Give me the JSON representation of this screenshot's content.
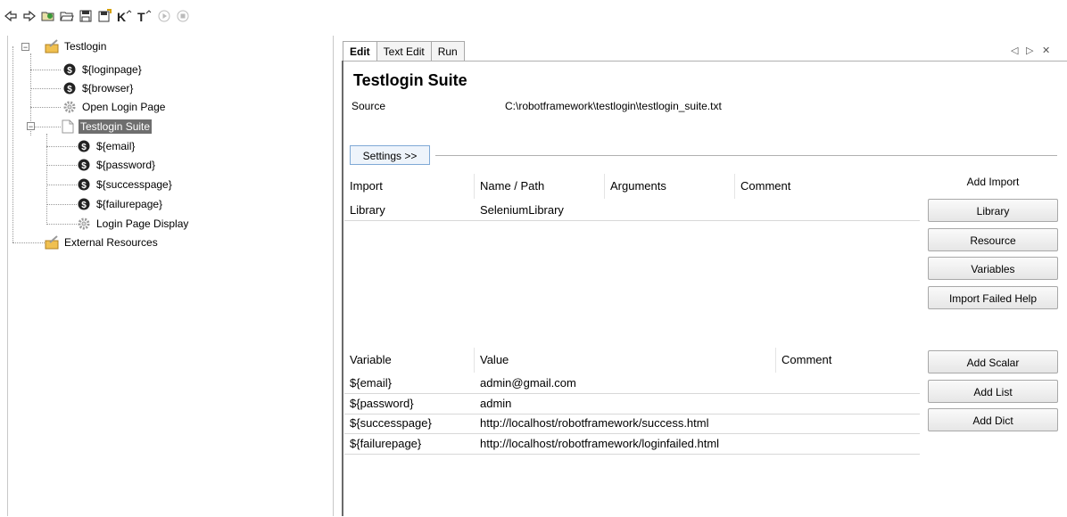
{
  "toolbar": {
    "icons": [
      "back-arrow-icon",
      "forward-arrow-icon",
      "open-directory-icon",
      "open-folder-icon",
      "save-icon",
      "save-all-icon",
      "keyword-search-icon",
      "test-search-icon",
      "run-icon",
      "stop-icon"
    ]
  },
  "tree": {
    "root": "Testlogin",
    "root_children": [
      "${loginpage}",
      "${browser}",
      "Open Login Page"
    ],
    "suite": "Testlogin Suite",
    "suite_children": [
      "${email}",
      "${password}",
      "${successpage}",
      "${failurepage}",
      "Login Page Display"
    ],
    "external": "External Resources"
  },
  "tabs": [
    "Edit",
    "Text Edit",
    "Run"
  ],
  "tab_controls": {
    "prev": "◁",
    "next": "▷",
    "close": "✕"
  },
  "editor": {
    "title": "Testlogin Suite",
    "source_label": "Source",
    "source_value": "C:\\robotframework\\testlogin\\testlogin_suite.txt",
    "settings_button": "Settings >>"
  },
  "imports": {
    "headers": [
      "Import",
      "Name / Path",
      "Arguments",
      "Comment"
    ],
    "rows": [
      [
        "Library",
        "SeleniumLibrary",
        "",
        ""
      ]
    ],
    "add_label": "Add Import",
    "buttons": [
      "Library",
      "Resource",
      "Variables",
      "Import Failed Help"
    ]
  },
  "variables": {
    "headers": [
      "Variable",
      "Value",
      "Comment"
    ],
    "rows": [
      [
        "${email}",
        "admin@gmail.com",
        ""
      ],
      [
        "${password}",
        "admin",
        ""
      ],
      [
        "${successpage}",
        "http://localhost/robotframework/success.html",
        ""
      ],
      [
        "${failurepage}",
        "http://localhost/robotframework/loginfailed.html",
        ""
      ]
    ],
    "buttons": [
      "Add Scalar",
      "Add List",
      "Add Dict"
    ]
  },
  "colors": {
    "selection": "#6e6e6e",
    "accent": "#7fa9d6"
  }
}
